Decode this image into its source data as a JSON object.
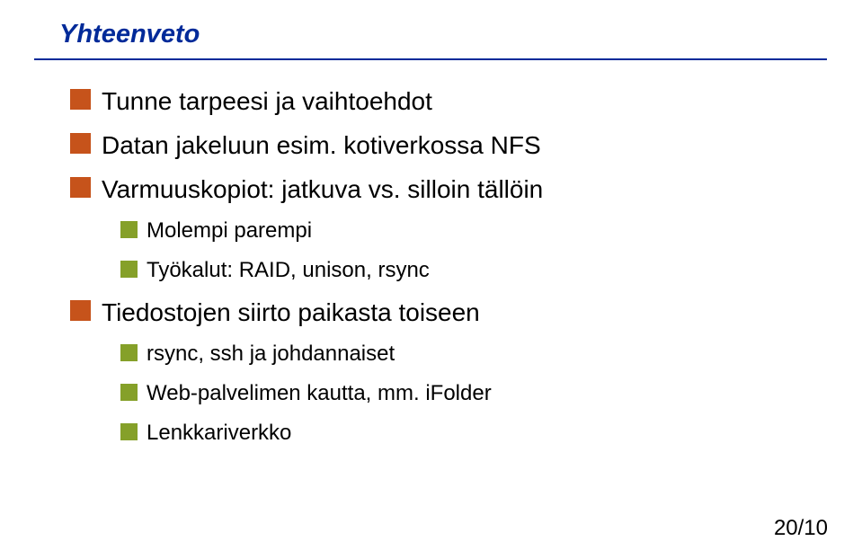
{
  "title": "Yhteenveto",
  "bullets": {
    "b1": "Tunne tarpeesi ja vaihtoehdot",
    "b2": "Datan jakeluun esim. kotiverkossa NFS",
    "b3": "Varmuuskopiot: jatkuva vs. silloin tällöin",
    "b3a": "Molempi parempi",
    "b3b": "Työkalut: RAID, unison, rsync",
    "b4": "Tiedostojen siirto paikasta toiseen",
    "b4a": "rsync, ssh ja johdannaiset",
    "b4b": "Web-palvelimen kautta, mm. iFolder",
    "b4c": "Lenkkariverkko"
  },
  "page": "20/10"
}
